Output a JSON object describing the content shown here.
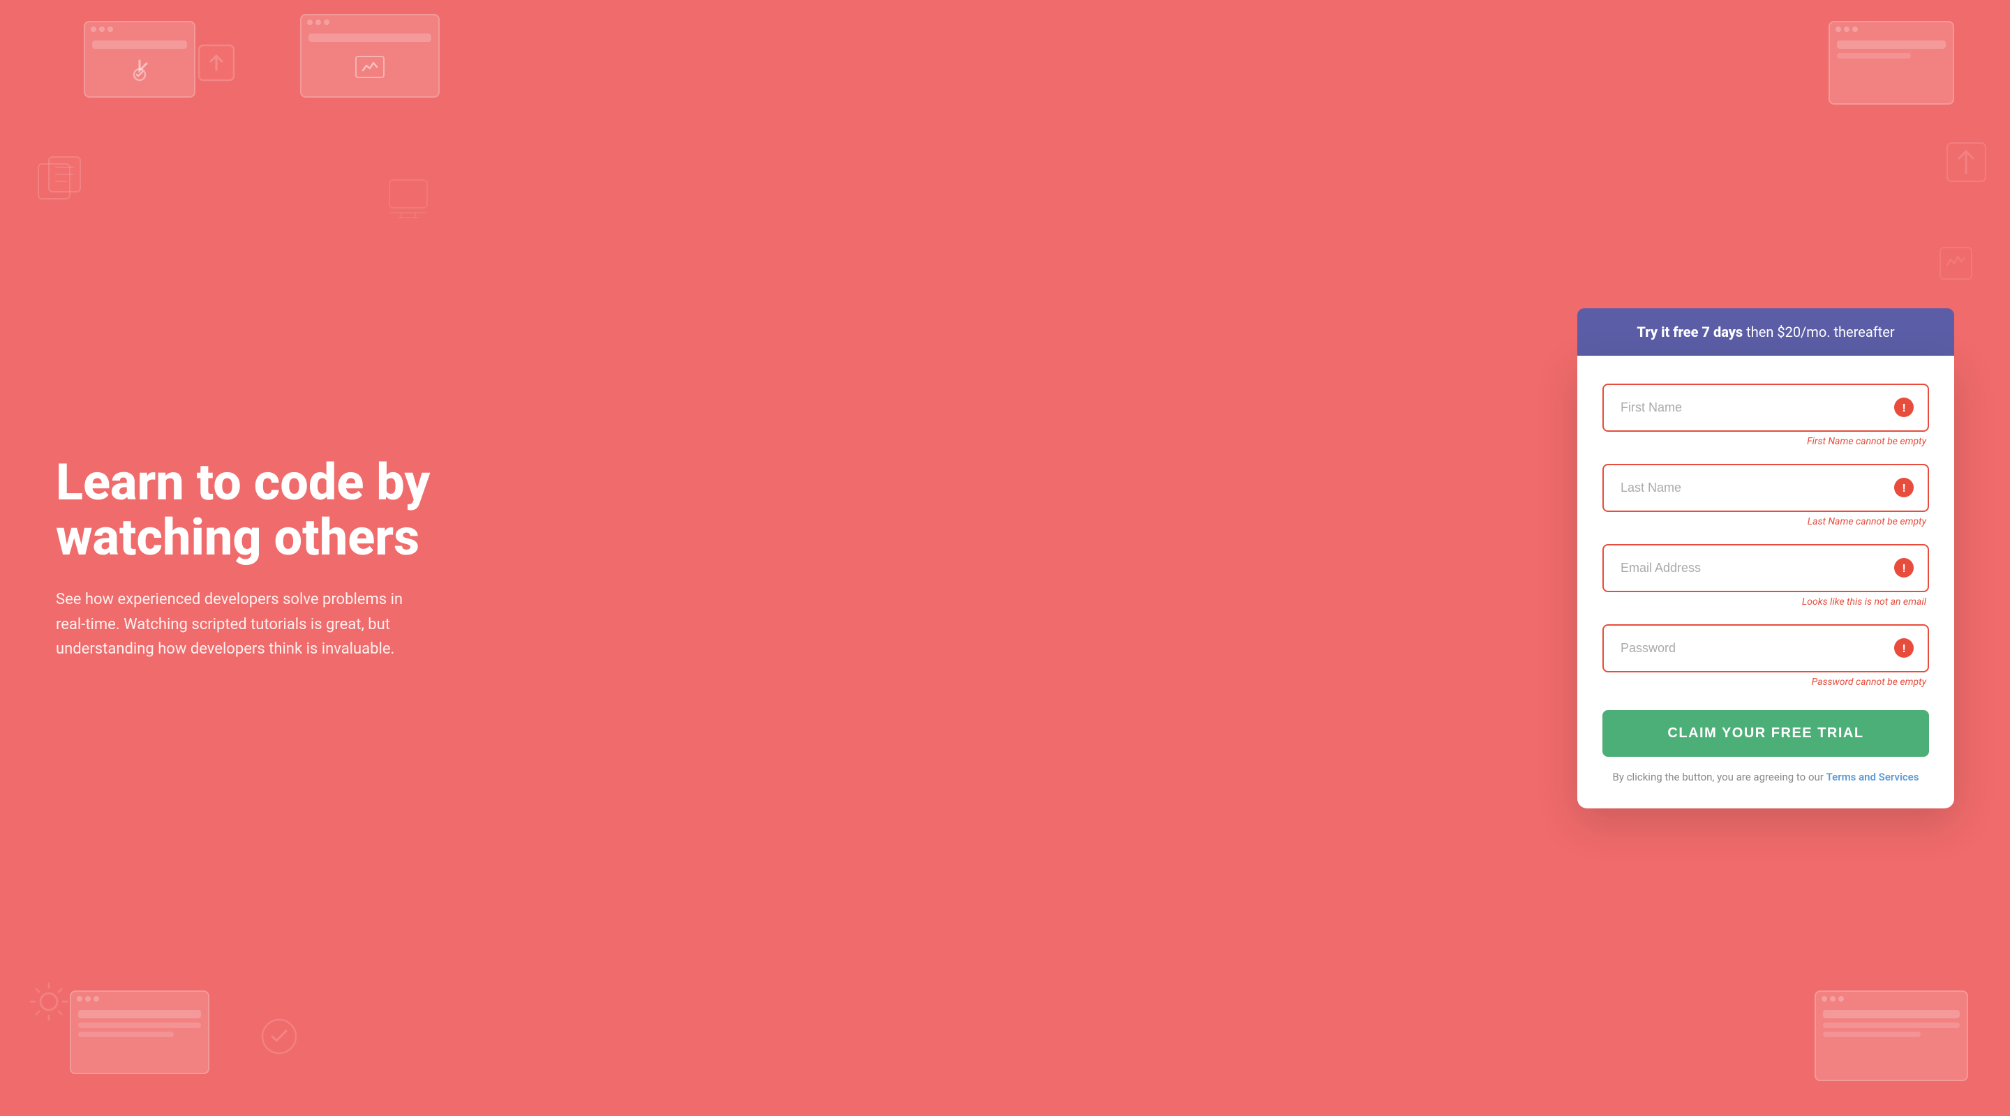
{
  "background": {
    "color": "#f06b6b"
  },
  "left": {
    "heading": "Learn to code by watching others",
    "subtext": "See how experienced developers solve problems in real-time. Watching scripted tutorials is great, but understanding how developers think is invaluable."
  },
  "banner": {
    "bold_text": "Try it free 7 days",
    "regular_text": " then $20/mo. thereafter"
  },
  "form": {
    "fields": [
      {
        "id": "first-name",
        "placeholder": "First Name",
        "type": "text",
        "error": "First Name cannot be empty"
      },
      {
        "id": "last-name",
        "placeholder": "Last Name",
        "type": "text",
        "error": "Last Name cannot be empty"
      },
      {
        "id": "email",
        "placeholder": "Email Address",
        "type": "email",
        "error": "Looks like this is not an email"
      },
      {
        "id": "password",
        "placeholder": "Password",
        "type": "password",
        "error": "Password cannot be empty"
      }
    ],
    "submit_button": "CLAIM YOUR FREE TRIAL",
    "terms_prefix": "By clicking the button, you are agreeing to our ",
    "terms_link": "Terms and Services"
  }
}
